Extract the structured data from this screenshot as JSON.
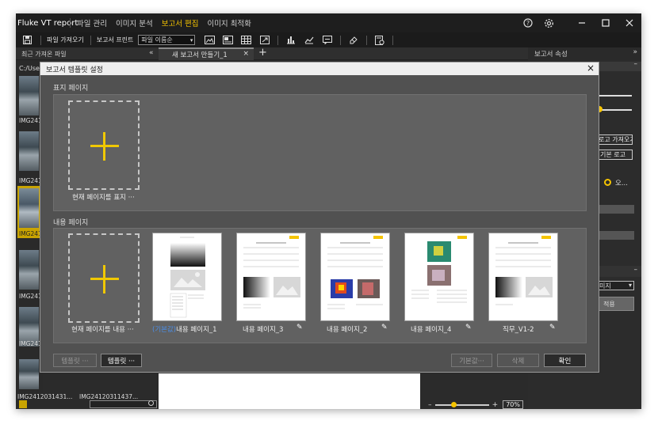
{
  "app": {
    "title": "Fluke VT report"
  },
  "menu": [
    {
      "label": "파일 관리",
      "active": false
    },
    {
      "label": "이미지 분석",
      "active": false
    },
    {
      "label": "보고서 편집",
      "active": true
    },
    {
      "label": "이미지 최적화",
      "active": false
    }
  ],
  "toolbar": {
    "import_label": "파일 가져오기",
    "print_label": "보고서 프린트",
    "sort_select": "파일 이름순"
  },
  "panels": {
    "recent_files": "최근 가져온 파일",
    "collapse_left": "«",
    "doc_tab": "새 보고서 만들기_1",
    "doc_tab_close": "×",
    "add_tab": "+",
    "report_props": "보고서 속성",
    "collapse_right": "»"
  },
  "sidebar": {
    "path": "C:/Use",
    "thumbs": [
      "IMG241",
      "IMG241",
      "IMG241",
      "IMG241",
      "IMG241",
      "IMG241"
    ]
  },
  "bottom": {
    "file1": "IMG2412031431...",
    "file2": "IMG24120311437...",
    "zoom": "70%"
  },
  "right_panel": {
    "import_logo": "로고 가져오기",
    "default_logo": "기본 로고",
    "option": "오...",
    "dropdown": "미지",
    "dropdown_arrow": "▾",
    "apply": "적용"
  },
  "dialog": {
    "title": "보고서 템플릿 설정",
    "close": "×",
    "cover_section": "표지 페이지",
    "cover_add_label": "현재 페이지를 표지 ···",
    "content_section": "내용 페이지",
    "content_add_label": "현재 페이지를 내용 ···",
    "templates": [
      {
        "default_prefix": "(기본값)",
        "name": "내용 페이지_1"
      },
      {
        "name": "내용 페이지_3"
      },
      {
        "name": "내용 페이지_2"
      },
      {
        "name": "내용 페이지_4"
      },
      {
        "name": "직무_V1-2"
      }
    ],
    "buttons": {
      "template_left": "템플릿 ···",
      "template_right": "템플릿 ···",
      "default": "기본값···",
      "delete": "삭제",
      "ok": "확인"
    }
  },
  "colors": {
    "accent": "#f5c400",
    "default_tag": "#4b8ee8",
    "dialog_bg": "#515151"
  }
}
